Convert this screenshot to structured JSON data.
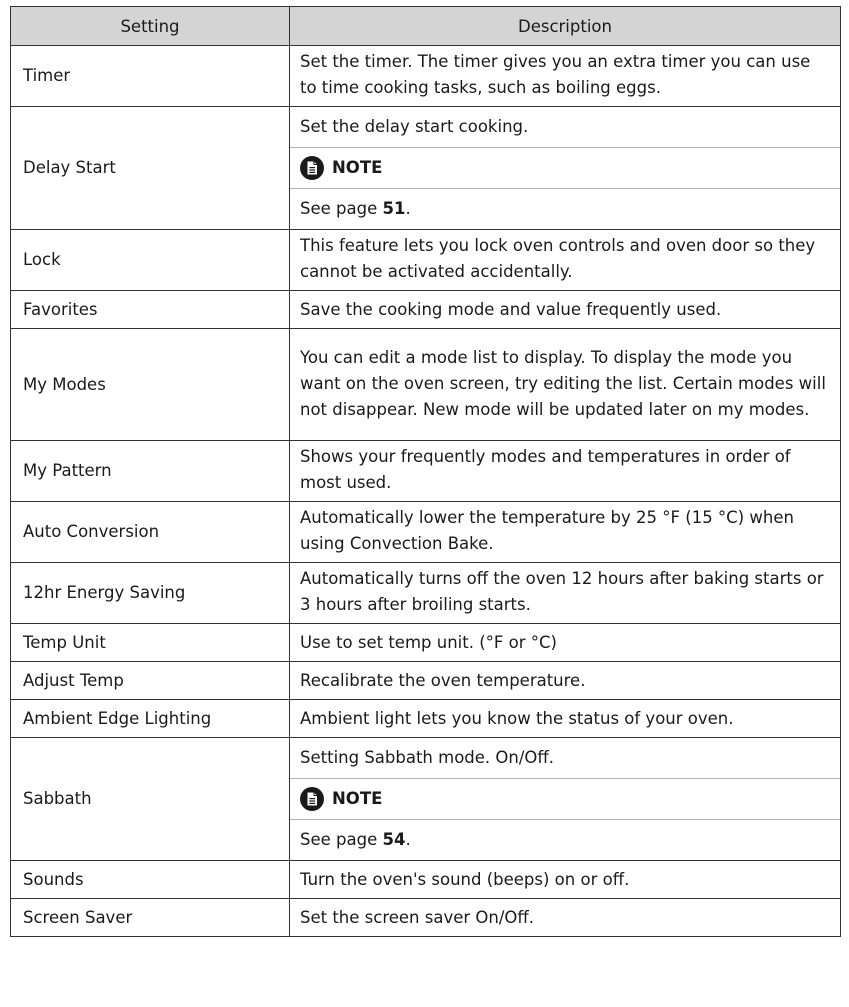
{
  "table": {
    "headers": [
      "Setting",
      "Description"
    ],
    "rows": [
      {
        "setting": "Timer",
        "description": "Set the timer. The timer gives you an extra timer you can use to time cooking tasks, such as boiling eggs."
      },
      {
        "setting": "Delay Start",
        "description": "Set the delay start cooking.",
        "note_label": "NOTE",
        "note_prefix": "See page ",
        "note_page": "51",
        "note_suffix": "."
      },
      {
        "setting": "Lock",
        "description": "This feature lets you lock oven controls and oven door so they cannot be activated accidentally."
      },
      {
        "setting": "Favorites",
        "description": "Save the cooking mode and value frequently used."
      },
      {
        "setting": "My Modes",
        "description": "You can edit a mode list to display. To display the mode you want on the oven screen, try editing the list. Certain modes will not disappear. New mode will be updated later on my modes."
      },
      {
        "setting": "My Pattern",
        "description": "Shows your frequently modes and temperatures in order of most used."
      },
      {
        "setting": "Auto Conversion",
        "description": "Automatically lower the temperature by 25 °F (15 °C) when using Convection Bake."
      },
      {
        "setting": "12hr Energy Saving",
        "description": "Automatically turns off the oven 12 hours after baking starts or 3 hours after broiling starts."
      },
      {
        "setting": "Temp Unit",
        "description": "Use to set temp unit. (°F or °C)"
      },
      {
        "setting": "Adjust Temp",
        "description": "Recalibrate the oven temperature."
      },
      {
        "setting": "Ambient Edge Lighting",
        "description": "Ambient light lets you know the status of your oven."
      },
      {
        "setting": "Sabbath",
        "description": "Setting Sabbath mode. On/Off.",
        "note_label": "NOTE",
        "note_prefix": "See page ",
        "note_page": "54",
        "note_suffix": "."
      },
      {
        "setting": "Sounds",
        "description": "Turn the oven's sound (beeps) on or off."
      },
      {
        "setting": "Screen Saver",
        "description": "Set the screen saver On/Off."
      }
    ]
  }
}
